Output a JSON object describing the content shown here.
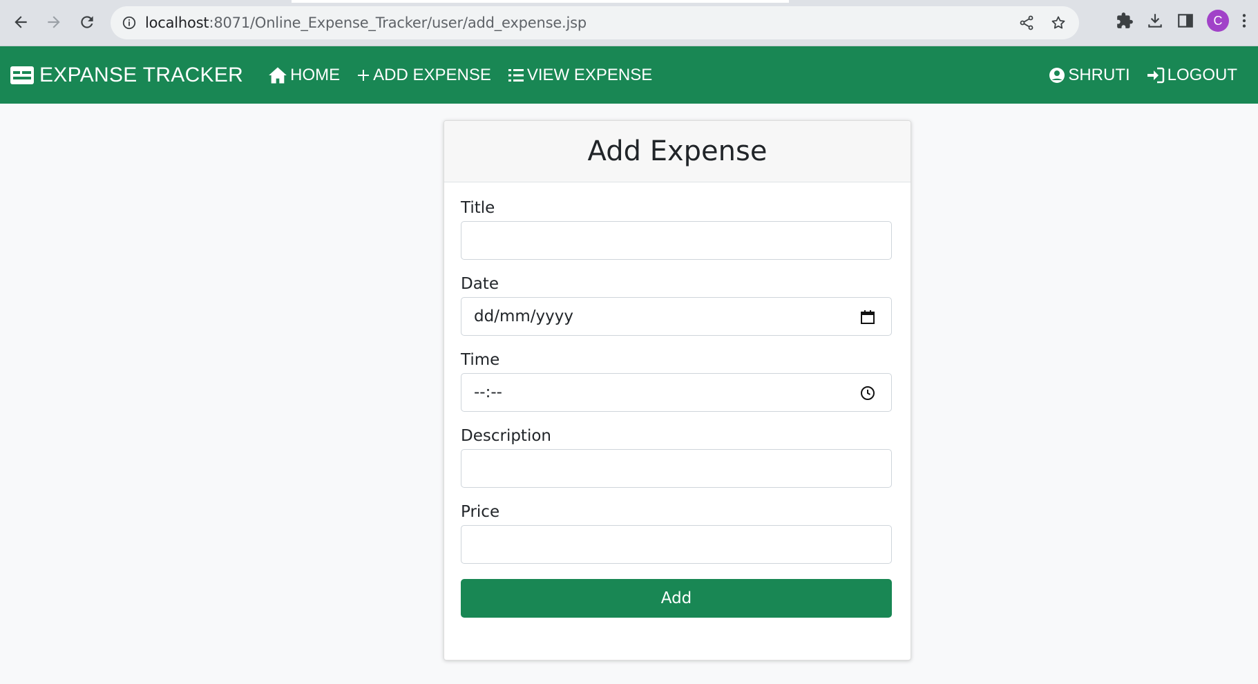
{
  "browser": {
    "url_host": "localhost",
    "url_path": ":8071/Online_Expense_Tracker/user/add_expense.jsp",
    "profile_initial": "C",
    "profile_color": "#a142c8"
  },
  "navbar": {
    "brand": "EXPANSE TRACKER",
    "brand_icon": "card-icon",
    "links": [
      {
        "label": "HOME",
        "icon": "home-icon"
      },
      {
        "label": "ADD EXPENSE",
        "icon": "plus-icon"
      },
      {
        "label": "VIEW EXPENSE",
        "icon": "list-icon"
      }
    ],
    "user": {
      "label": "SHRUTI",
      "icon": "user-circle-icon"
    },
    "logout": {
      "label": "LOGOUT",
      "icon": "sign-in-icon"
    },
    "color": "#198754"
  },
  "form": {
    "title": "Add Expense",
    "fields": [
      {
        "label": "Title",
        "value": ""
      },
      {
        "label": "Date",
        "value": "dd/mm/yyyy",
        "icon": "calendar-icon"
      },
      {
        "label": "Time",
        "value": "--:--",
        "icon": "clock-icon"
      },
      {
        "label": "Description",
        "value": ""
      },
      {
        "label": "Price",
        "value": ""
      }
    ],
    "submit_label": "Add"
  }
}
